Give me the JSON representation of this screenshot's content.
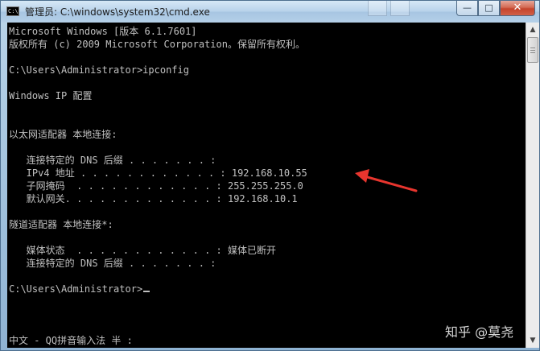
{
  "window": {
    "title": "管理员: C:\\windows\\system32\\cmd.exe",
    "icon": "cmd-console-icon",
    "icon_text": "C:\\",
    "minimize_glyph": "—",
    "maximize_glyph": "□",
    "close_glyph": "✕"
  },
  "console": {
    "line_01": "Microsoft Windows [版本 6.1.7601]",
    "line_02": "版权所有 (c) 2009 Microsoft Corporation。保留所有权利。",
    "line_04": "C:\\Users\\Administrator>ipconfig",
    "line_06": "Windows IP 配置",
    "line_09": "以太网适配器 本地连接:",
    "line_11": "   连接特定的 DNS 后缀 . . . . . . . :",
    "line_12": "   IPv4 地址 . . . . . . . . . . . . : 192.168.10.55",
    "line_13": "   子网掩码  . . . . . . . . . . . . : 255.255.255.0",
    "line_14": "   默认网关. . . . . . . . . . . . . : 192.168.10.1",
    "line_16": "隧道适配器 本地连接*:",
    "line_18": "   媒体状态  . . . . . . . . . . . . : 媒体已断开",
    "line_19": "   连接特定的 DNS 后缀 . . . . . . . :",
    "line_22": "C:\\Users\\Administrator>",
    "line_26": "中文 - QQ拼音输入法 半 :"
  },
  "annotation": {
    "color": "#e8352e"
  },
  "watermark": {
    "text": "知乎 @莫尧"
  },
  "colors": {
    "console_bg": "#000000",
    "console_fg": "#c0c0c0"
  }
}
